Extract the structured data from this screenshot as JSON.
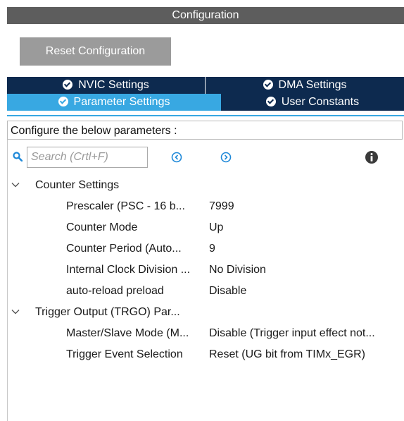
{
  "header": {
    "title": "Configuration"
  },
  "toolbar": {
    "reset_label": "Reset Configuration"
  },
  "tabs": [
    {
      "label": "NVIC Settings",
      "active": false,
      "icon": "check-circle-icon"
    },
    {
      "label": "DMA Settings",
      "active": false,
      "icon": "check-circle-icon"
    },
    {
      "label": "Parameter Settings",
      "active": true,
      "icon": "check-circle-icon"
    },
    {
      "label": "User Constants",
      "active": false,
      "icon": "check-circle-icon"
    }
  ],
  "panel": {
    "description": "Configure the below parameters :",
    "search": {
      "placeholder": "Search (Crtl+F)",
      "value": ""
    },
    "icons": {
      "search": "search-icon",
      "prev": "previous-icon",
      "next": "next-icon",
      "info": "info-icon"
    }
  },
  "groups": [
    {
      "label": "Counter Settings",
      "expanded": true,
      "rows": [
        {
          "name": "Prescaler (PSC - 16 b...",
          "value": "7999"
        },
        {
          "name": "Counter Mode",
          "value": "Up"
        },
        {
          "name": "Counter Period (Auto...",
          "value": "9"
        },
        {
          "name": "Internal Clock Division ...",
          "value": "No Division"
        },
        {
          "name": "auto-reload preload",
          "value": "Disable"
        }
      ]
    },
    {
      "label": "Trigger Output (TRGO) Par...",
      "expanded": true,
      "rows": [
        {
          "name": "Master/Slave Mode (M...",
          "value": "Disable (Trigger input effect not..."
        },
        {
          "name": "Trigger Event Selection",
          "value": "Reset (UG bit from TIMx_EGR)"
        }
      ]
    }
  ],
  "colors": {
    "tab_dark": "#0d2a4f",
    "tab_active": "#38a8e2",
    "title_bg": "#5d5d5d",
    "reset_bg": "#9b9b9b",
    "icon_blue": "#1e88d8"
  }
}
